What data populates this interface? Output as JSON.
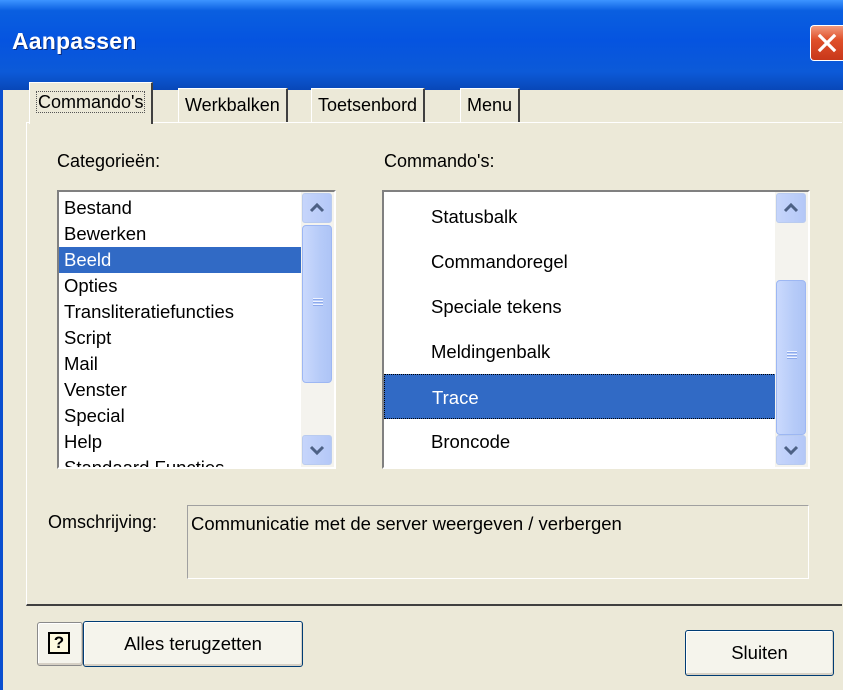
{
  "window": {
    "title": "Aanpassen"
  },
  "tabs": [
    {
      "label": "Commando's",
      "active": true
    },
    {
      "label": "Werkbalken",
      "active": false
    },
    {
      "label": "Toetsenbord",
      "active": false
    },
    {
      "label": "Menu",
      "active": false
    }
  ],
  "categories": {
    "label": "Categorieën:",
    "items": [
      "Bestand",
      "Bewerken",
      "Beeld",
      "Opties",
      "Transliteratiefuncties",
      "Script",
      "Mail",
      "Venster",
      "Special",
      "Help",
      "Standaard Functies"
    ],
    "selected": "Beeld"
  },
  "commands": {
    "label": "Commando's:",
    "items": [
      "Statusbalk",
      "Commandoregel",
      "Speciale tekens",
      "Meldingenbalk",
      "Trace",
      "Broncode"
    ],
    "selected": "Trace"
  },
  "description": {
    "label": "Omschrijving:",
    "text": "Communicatie met de server weergeven / verbergen"
  },
  "buttons": {
    "reset": "Alles terugzetten",
    "close": "Sluiten"
  },
  "colors": {
    "selection": "#316ac5",
    "titlebar": "#0554e0",
    "dialog_background": "#ece9d8"
  }
}
